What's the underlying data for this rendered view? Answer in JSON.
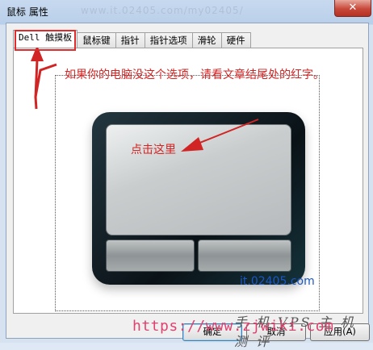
{
  "window": {
    "title": "鼠标 属性",
    "title_ghost": "www.it.02405.com/my02405/",
    "close_glyph": "✕"
  },
  "tabs": [
    {
      "label": "Dell 触摸板",
      "active": true
    },
    {
      "label": "鼠标键",
      "active": false
    },
    {
      "label": "指针",
      "active": false
    },
    {
      "label": "指针选项",
      "active": false
    },
    {
      "label": "滑轮",
      "active": false
    },
    {
      "label": "硬件",
      "active": false
    }
  ],
  "annotations": {
    "note": "如果你的电脑没这个选项，请看文章结尾处的红字。",
    "click_here": "点击这里",
    "watermark": "it.02405.com",
    "overlay_url": "https://www.zjwiki.com",
    "overlay_cn": "手 机 VPS 主 机 测 评",
    "accent_red": "#d12424"
  },
  "buttons": {
    "ok": "确定",
    "cancel": "取消",
    "apply": "应用(A)"
  }
}
